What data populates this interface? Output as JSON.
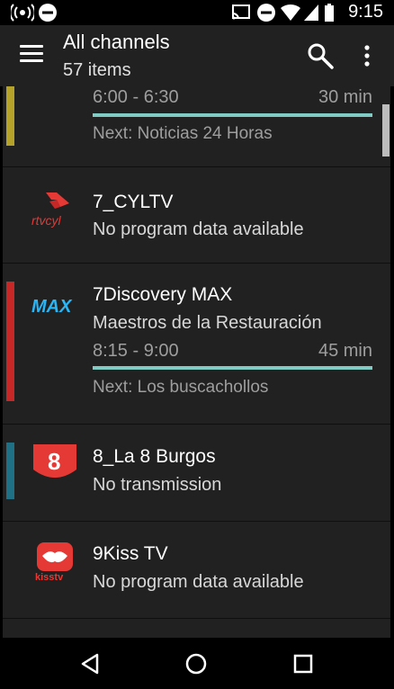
{
  "status_bar": {
    "time": "9:15",
    "icons": [
      "radio-signal-icon",
      "do-not-disturb-icon",
      "cast-icon",
      "do-not-disturb-icon",
      "wifi-icon",
      "cell-signal-icon",
      "battery-icon"
    ]
  },
  "app_bar": {
    "title": "All channels",
    "subtitle": "57 items",
    "icons": [
      "menu-icon",
      "search-icon",
      "more-vert-icon"
    ]
  },
  "channels": [
    {
      "name": "",
      "time_range": "6:00 - 6:30",
      "duration": "30 min",
      "next": "Next: Noticias 24 Horas",
      "stripe_color": "#b5a22a",
      "progress": 1.0
    },
    {
      "name": "7_CYLTV",
      "subtitle": "No program data available",
      "logo_text": "rtvcyl",
      "logo": "rtvcyl-logo"
    },
    {
      "name": "7Discovery MAX",
      "subtitle": "Maestros de la Restauración",
      "time_range": "8:15 - 9:00",
      "duration": "45 min",
      "next": "Next: Los buscachollos",
      "stripe_color": "#c62828",
      "progress": 1.0,
      "logo_text": "MAX",
      "logo": "discovery-max-logo"
    },
    {
      "name": "8_La 8 Burgos",
      "subtitle": "No transmission",
      "stripe_color": "#1f6f85",
      "logo_text": "8",
      "logo": "la8-logo"
    },
    {
      "name": "9Kiss TV",
      "subtitle": "No program data available",
      "logo_text": "kisstv",
      "logo": "kiss-tv-logo"
    }
  ],
  "nav_bar": {
    "icons": [
      "back-icon",
      "home-icon",
      "recents-icon"
    ]
  }
}
